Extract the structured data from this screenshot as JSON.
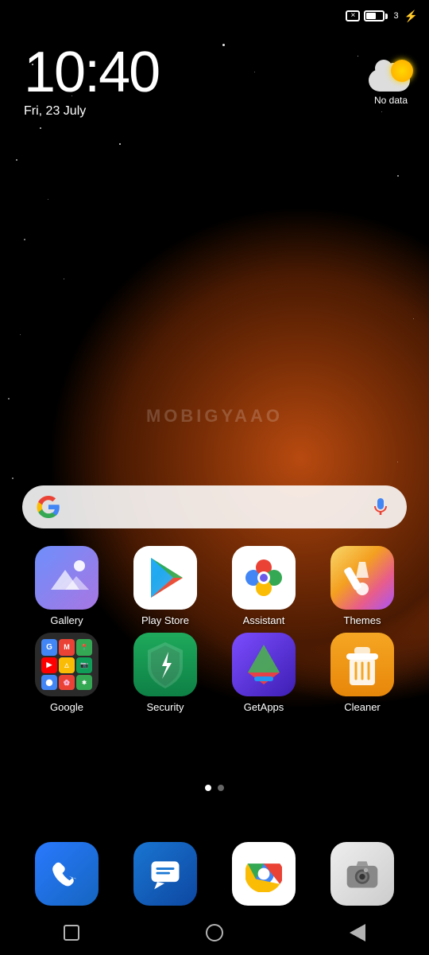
{
  "statusBar": {
    "battery": "3",
    "boltLabel": "⚡"
  },
  "clock": {
    "time": "10:40",
    "date": "Fri, 23 July"
  },
  "weather": {
    "label": "No data"
  },
  "search": {
    "placeholder": ""
  },
  "watermark": "MOBIGYAAO",
  "apps": {
    "row1": [
      {
        "name": "Gallery",
        "icon": "gallery"
      },
      {
        "name": "Play Store",
        "icon": "playstore"
      },
      {
        "name": "Assistant",
        "icon": "assistant"
      },
      {
        "name": "Themes",
        "icon": "themes"
      }
    ],
    "row2": [
      {
        "name": "Google",
        "icon": "google"
      },
      {
        "name": "Security",
        "icon": "security"
      },
      {
        "name": "GetApps",
        "icon": "getapps"
      },
      {
        "name": "Cleaner",
        "icon": "cleaner"
      }
    ]
  },
  "dock": [
    {
      "name": "Phone",
      "icon": "phone"
    },
    {
      "name": "Messages",
      "icon": "messages"
    },
    {
      "name": "Chrome",
      "icon": "chrome"
    },
    {
      "name": "Camera",
      "icon": "camera"
    }
  ],
  "nav": {
    "recents": "□",
    "home": "○",
    "back": "◁"
  }
}
